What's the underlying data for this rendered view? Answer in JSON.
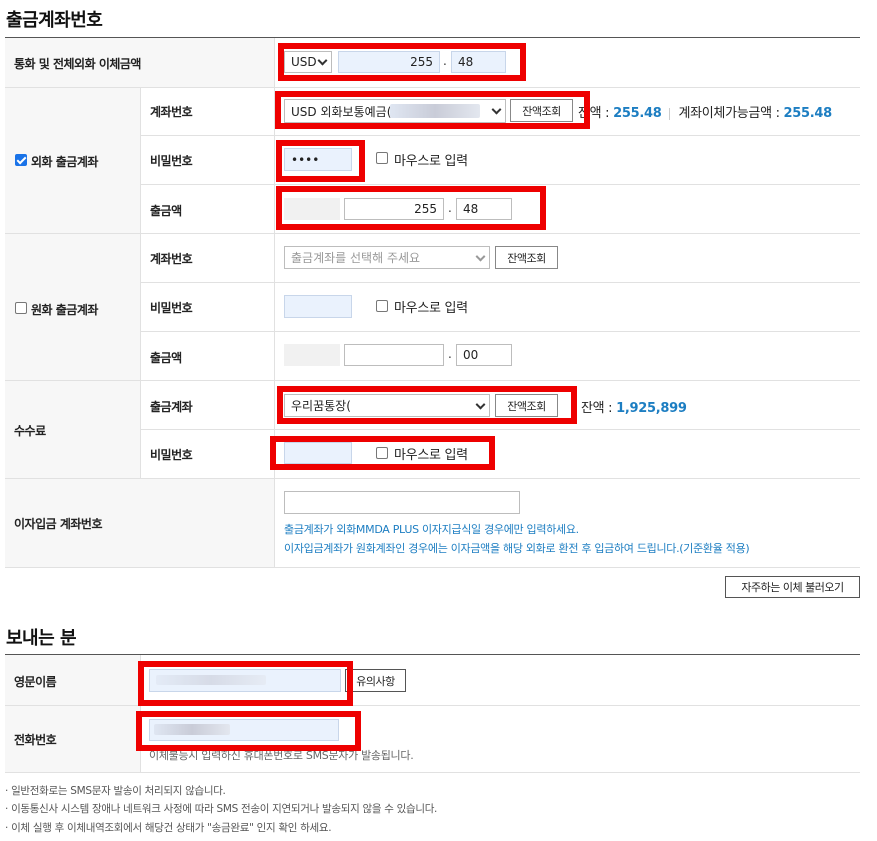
{
  "withdraw": {
    "title": "출금계좌번호",
    "currency_amount_label": "통화 및 전체외화 이체금액",
    "currency_selected": "USD",
    "amount_int": "255",
    "amount_dec": "48",
    "foreign": {
      "section_label": "외화 출금계좌",
      "checked": true,
      "account_label": "계좌번호",
      "account_value": "USD 외화보통예금(",
      "balance_button": "잔액조회",
      "balance_label": "잔액 : ",
      "balance_value": "255.48",
      "transferable_label": "계좌이체가능금액 : ",
      "transferable_value": "255.48",
      "password_label": "비밀번호",
      "password_value": "••••",
      "mouse_input": "마우스로 입력",
      "amount_label": "출금액",
      "amount_int": "255",
      "amount_dec": "48"
    },
    "krw": {
      "section_label": "원화 출금계좌",
      "checked": false,
      "account_label": "계좌번호",
      "account_placeholder": "출금계좌를 선택해 주세요",
      "balance_button": "잔액조회",
      "password_label": "비밀번호",
      "mouse_input": "마우스로 입력",
      "amount_label": "출금액",
      "amount_dec": "00"
    },
    "fee": {
      "section_label": "수수료",
      "account_label": "출금계좌",
      "account_value": "우리꿈통장(",
      "balance_button": "잔액조회",
      "balance_label": "잔액 : ",
      "balance_value": "1,925,899",
      "password_label": "비밀번호",
      "mouse_input": "마우스로 입력"
    },
    "interest": {
      "section_label": "이자입금 계좌번호",
      "note1": "출금계좌가 외화MMDA PLUS 이자지급식일 경우에만 입력하세요.",
      "note2": "이자입금계좌가 원화계좌인 경우에는 이자금액을 해당 외화로 환전 후 입금하여 드립니다.(기준환율 적용)"
    },
    "favorites_button": "자주하는 이체 불러오기"
  },
  "sender": {
    "title": "보내는 분",
    "english_name_label": "영문이름",
    "caution_button": "유의사항",
    "phone_label": "전화번호",
    "phone_note": "이체불능시 입력하신 휴대폰번호로 SMS문자가 발송됩니다."
  },
  "notes": [
    "· 일반전화로는 SMS문자 발송이 처리되지 않습니다.",
    "· 이동통신사 시스템 장애나 네트워크 사정에 따라 SMS 전송이 지연되거나 발송되지 않을 수 있습니다.",
    "· 이체 실행 후 이체내역조회에서 해당건 상태가 \"송금완료\" 인지 확인 하세요."
  ],
  "colors": {
    "highlight": "#ee0000",
    "value_blue": "#1d7ec2",
    "checkbox_blue": "#1a73e8"
  }
}
